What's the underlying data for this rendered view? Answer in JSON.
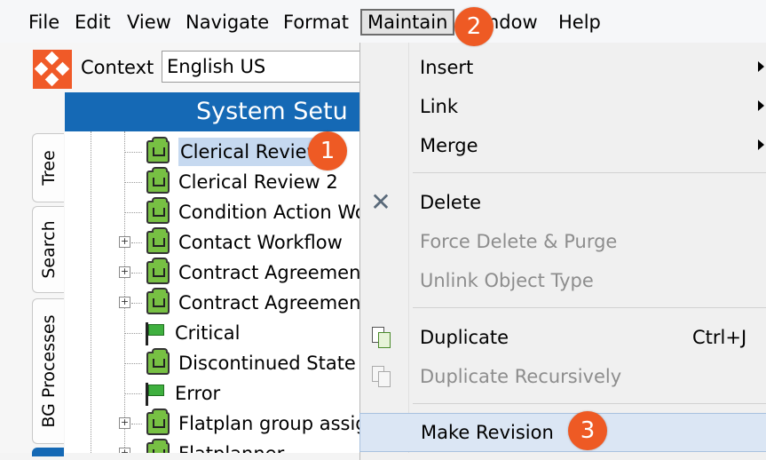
{
  "menubar": {
    "items": [
      "File",
      "Edit",
      "View",
      "Navigate",
      "Format",
      "Maintain",
      "Window",
      "Help"
    ],
    "active": "Maintain",
    "window_visible": "ndow"
  },
  "context": {
    "label": "Context",
    "value": "English US"
  },
  "panel": {
    "title": "System Setu"
  },
  "side_tabs": [
    "Tree",
    "Search",
    "BG Processes"
  ],
  "tree": {
    "items": [
      {
        "label": "Clerical Review",
        "icon": "workflow-icon",
        "expandable": false,
        "selected": true
      },
      {
        "label": "Clerical Review 2",
        "icon": "workflow-icon",
        "expandable": false
      },
      {
        "label": "Condition Action Wor",
        "icon": "workflow-icon",
        "expandable": false
      },
      {
        "label": "Contact Workflow",
        "icon": "workflow-icon",
        "expandable": true
      },
      {
        "label": "Contract Agreements",
        "icon": "workflow-icon",
        "expandable": true
      },
      {
        "label": "Contract Agreements",
        "icon": "workflow-icon",
        "expandable": true
      },
      {
        "label": "Critical",
        "icon": "flag-icon",
        "expandable": false
      },
      {
        "label": "Discontinued State",
        "icon": "workflow-icon",
        "expandable": false
      },
      {
        "label": "Error",
        "icon": "flag-icon",
        "expandable": false
      },
      {
        "label": "Flatplan group assign",
        "icon": "workflow-icon",
        "expandable": true
      },
      {
        "label": "Flatplanner",
        "icon": "workflow-icon",
        "expandable": true
      }
    ]
  },
  "menu": {
    "items": [
      {
        "label": "Insert",
        "submenu": true,
        "enabled": true
      },
      {
        "label": "Link",
        "submenu": true,
        "enabled": true
      },
      {
        "label": "Merge",
        "submenu": true,
        "enabled": true
      },
      {
        "label": "Delete",
        "enabled": true,
        "icon": "delete-icon"
      },
      {
        "label": "Force Delete & Purge",
        "enabled": false
      },
      {
        "label": "Unlink Object Type",
        "enabled": false
      },
      {
        "label": "Duplicate",
        "enabled": true,
        "shortcut": "Ctrl+J",
        "icon": "duplicate-icon"
      },
      {
        "label": "Duplicate Recursively",
        "enabled": false,
        "icon": "duplicate-recursively-icon"
      },
      {
        "label": "Make Revision",
        "enabled": true,
        "highlighted": true
      }
    ]
  },
  "annotations": [
    "1",
    "2",
    "3"
  ],
  "colors": {
    "accent": "#ee5a24",
    "header": "#1569b5",
    "workflow_icon": "#77c043",
    "selection": "#c6d9f0"
  }
}
